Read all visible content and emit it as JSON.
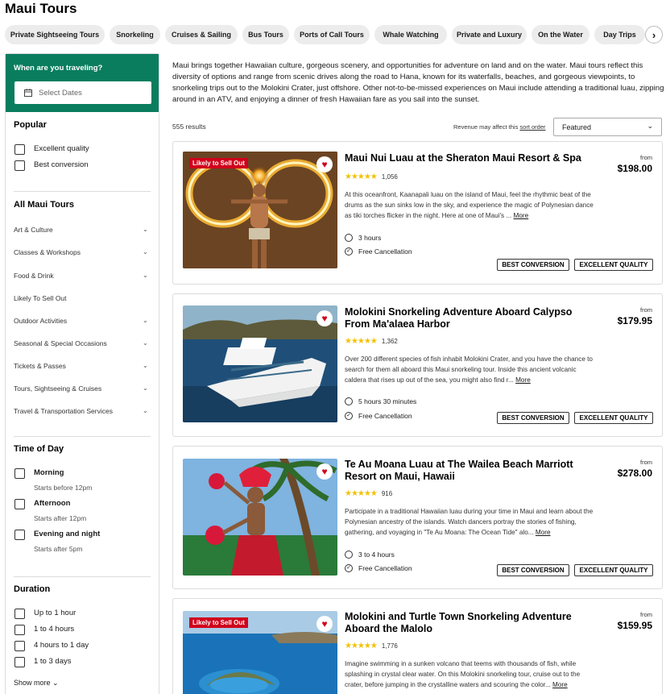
{
  "page": {
    "title": "Maui Tours"
  },
  "chips": [
    {
      "label": "Private Sightseeing Tours"
    },
    {
      "label": "Snorkeling"
    },
    {
      "label": "Cruises & Sailing"
    },
    {
      "label": "Bus Tours"
    },
    {
      "label": "Ports of Call Tours"
    },
    {
      "label": "Whale Watching"
    },
    {
      "label": "Private and Luxury"
    },
    {
      "label": "On the Water"
    },
    {
      "label": "Day Trips"
    }
  ],
  "sidebar": {
    "travel_title": "When are you traveling?",
    "date_placeholder": "Select Dates",
    "popular_heading": "Popular",
    "popular": [
      "Excellent quality",
      "Best conversion"
    ],
    "all_heading": "All Maui Tours",
    "categories": [
      "Art & Culture",
      "Classes & Workshops",
      "Food & Drink",
      "Likely To Sell Out",
      "Outdoor Activities",
      "Seasonal & Special Occasions",
      "Tickets & Passes",
      "Tours, Sightseeing & Cruises",
      "Travel & Transportation Services"
    ],
    "time_heading": "Time of Day",
    "times": [
      {
        "label": "Morning",
        "sub": "Starts before 12pm"
      },
      {
        "label": "Afternoon",
        "sub": "Starts after 12pm"
      },
      {
        "label": "Evening and night",
        "sub": "Starts after 5pm"
      }
    ],
    "duration_heading": "Duration",
    "durations": [
      "Up to 1 hour",
      "1 to 4 hours",
      "4 hours to 1 day",
      "1 to 3 days"
    ],
    "show_more": "Show more"
  },
  "intro": "Maui brings together Hawaiian culture, gorgeous scenery, and opportunities for adventure on land and on the water. Maui tours reflect this diversity of options and range from scenic drives along the road to Hana, known for its waterfalls, beaches, and gorgeous viewpoints, to snorkeling trips out to the Molokini Crater, just offshore. Other not-to-be-missed experiences on Maui include attending a traditional luau, zipping around in an ATV, and enjoying a dinner of fresh Hawaiian fare as you sail into the sunset.",
  "results": {
    "count": "555 results",
    "revenue_note": "Revenue may affect this",
    "sort_order_link": "sort order",
    "sort_value": "Featured"
  },
  "cards": [
    {
      "title": "Maui Nui Luau at the Sheraton Maui Resort & Spa",
      "badge": "Likely to Sell Out",
      "stars": "★★★★★",
      "reviews": "1,056",
      "description": "At this oceanfront, Kaanapali luau on the island of Maui, feel the rhythmic beat of the drums as the sun sinks low in the sky, and experience the magic of Polynesian dance as tiki torches flicker in the night. Here at one of Maui's ...",
      "more": "More",
      "duration": "3 hours",
      "cancellation": "Free Cancellation",
      "price_from": "from",
      "price": "$198.00",
      "tags": [
        "BEST CONVERSION",
        "EXCELLENT QUALITY"
      ]
    },
    {
      "title": "Molokini Snorkeling Adventure Aboard Calypso From Ma'alaea Harbor",
      "badge": "",
      "stars": "★★★★★",
      "reviews": "1,362",
      "description": "Over 200 different species of fish inhabit Molokini Crater, and you have the chance to search for them all aboard this Maui snorkeling tour. Inside this ancient volcanic caldera that rises up out of the sea, you might also find r...",
      "more": "More",
      "duration": "5 hours 30 minutes",
      "cancellation": "Free Cancellation",
      "price_from": "from",
      "price": "$179.95",
      "tags": [
        "BEST CONVERSION",
        "EXCELLENT QUALITY"
      ]
    },
    {
      "title": "Te Au Moana Luau at The Wailea Beach Marriott Resort on Maui, Hawaii",
      "badge": "",
      "stars": "★★★★★",
      "reviews": "916",
      "description": "Participate in a traditional Hawaiian luau during your time in Maui and learn about the Polynesian ancestry of the islands. Watch dancers portray the stories of fishing, gathering, and voyaging in \"Te Au Moana: The Ocean Tide\" alo...",
      "more": "More",
      "duration": "3 to 4 hours",
      "cancellation": "Free Cancellation",
      "price_from": "from",
      "price": "$278.00",
      "tags": [
        "BEST CONVERSION",
        "EXCELLENT QUALITY"
      ]
    },
    {
      "title": "Molokini and Turtle Town Snorkeling Adventure Aboard the Malolo",
      "badge": "Likely to Sell Out",
      "stars": "★★★★★",
      "reviews": "1,776",
      "description": "Imagine swimming in a sunken volcano that teems with thousands of fish, while splashing in crystal clear water. On this Molokini snorkeling tour, cruise out to the crater, before jumping in the crystalline waters and scouring the color...",
      "more": "More",
      "price_from": "from",
      "price": "$159.95"
    }
  ],
  "colors": {
    "green": "#0a7d5e",
    "red_badge": "#d0021b",
    "star": "#f2c200"
  }
}
